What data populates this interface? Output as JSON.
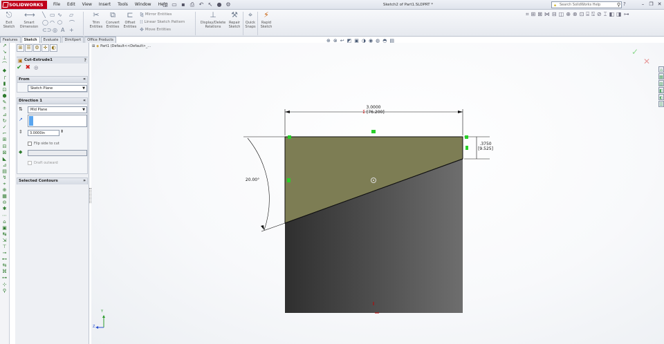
{
  "app": {
    "name": "SOLIDWORKS",
    "document_title": "Sketch2 of Part1.SLDPRT *"
  },
  "menu": [
    "File",
    "Edit",
    "View",
    "Insert",
    "Tools",
    "Window",
    "Help"
  ],
  "search": {
    "placeholder": "Search SolidWorks Help"
  },
  "ribbon": {
    "exit_sketch": "Exit Sketch",
    "smart_dimension": "Smart Dimension",
    "trim_entities": "Trim Entities",
    "convert_entities": "Convert Entities",
    "offset_entities": "Offset Entities",
    "mirror_entities": "Mirror Entities",
    "linear_pattern": "Linear Sketch Pattern",
    "move_entities": "Move Entities",
    "display_delete_relations": "Display/Delete Relations",
    "repair_sketch": "Repair Sketch",
    "quick_snaps": "Quick Snaps",
    "rapid_sketch": "Rapid Sketch"
  },
  "tabs": [
    "Features",
    "Sketch",
    "Evaluate",
    "DimXpert",
    "Office Products"
  ],
  "active_tab": "Sketch",
  "property_manager": {
    "feature_title": "Cut-Extrude1",
    "from_group": {
      "title": "From",
      "value": "Sketch Plane"
    },
    "direction_group": {
      "title": "Direction 1",
      "end_condition": "Mid Plane",
      "depth": "3.0000in",
      "flip_label": "Flip side to cut",
      "draft_label": "Draft outward"
    },
    "selected_contours": {
      "title": "Selected Contours"
    }
  },
  "breadcrumb": "Part1 (Default<<Default>_...",
  "dimensions": {
    "width_in": "3.0000",
    "width_mm": "[76.200]",
    "offset_in": ".3750",
    "offset_mm": "[9.525]",
    "angle": "20.00°"
  },
  "axis": {
    "y": "Y",
    "z": "Z"
  },
  "colors": {
    "profile_fill": "#7d7d54",
    "body_dark": "#2f2f2f",
    "body_light": "#6e6e6e",
    "sketch_relation": "#2ad02a",
    "accent_red": "#c00000"
  }
}
